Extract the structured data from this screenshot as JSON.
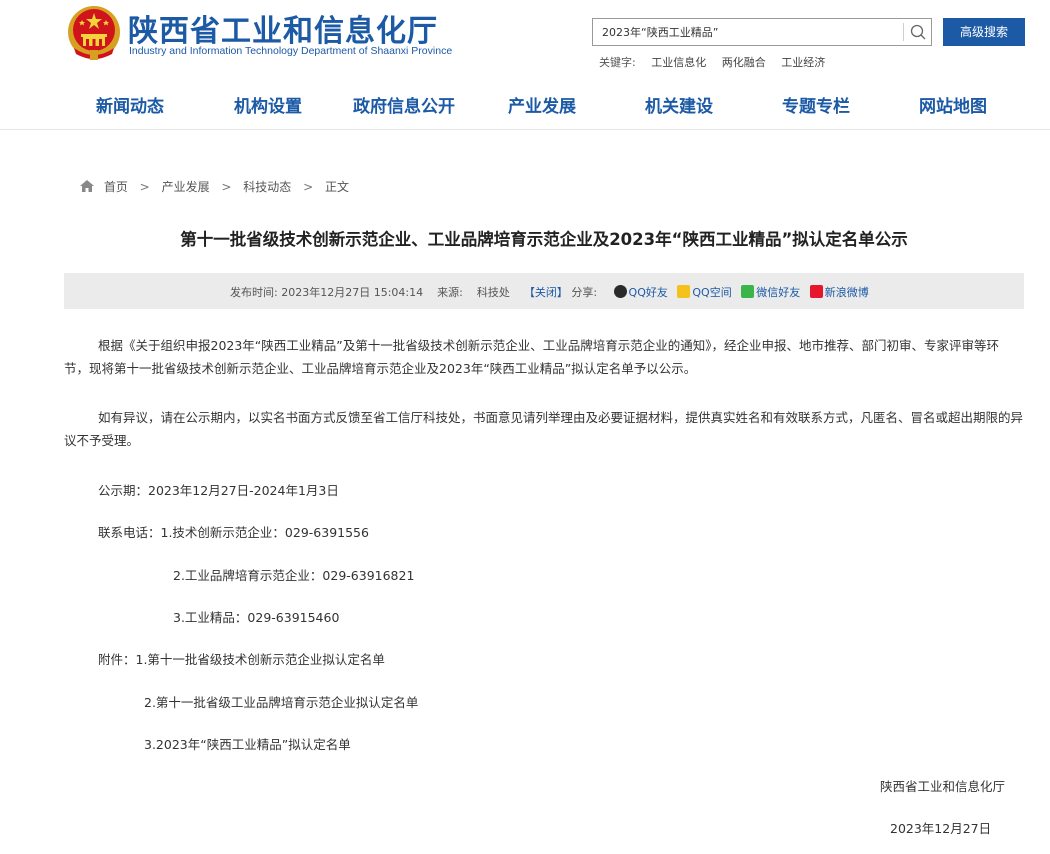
{
  "header": {
    "title": "陕西省工业和信息化厅",
    "subtitle": "Industry and Information Technology Department of Shaanxi Province"
  },
  "search": {
    "value": "2023年“陕西工业精品”",
    "advanced_label": "高级搜索"
  },
  "keywords": {
    "label": "关键字:",
    "items": [
      "工业信息化",
      "两化融合",
      "工业经济"
    ]
  },
  "nav": {
    "items": [
      "新闻动态",
      "机构设置",
      "政府信息公开",
      "产业发展",
      "机关建设",
      "专题专栏",
      "网站地图"
    ]
  },
  "breadcrumb": {
    "items": [
      "首页",
      "产业发展",
      "科技动态",
      "正文"
    ],
    "separator": ">"
  },
  "article": {
    "title": "第十一批省级技术创新示范企业、工业品牌培育示范企业及2023年“陕西工业精品”拟认定名单公示",
    "meta": {
      "time_label": "发布时间:",
      "time": "2023年12月27日 15:04:14",
      "source_label": "来源:",
      "source": "科技处",
      "close": "【关闭】",
      "share_label": "分享:",
      "shares": [
        "QQ好友",
        "QQ空间",
        "微信好友",
        "新浪微博"
      ]
    },
    "paragraphs": [
      "根据《关于组织申报2023年“陕西工业精品”及第十一批省级技术创新示范企业、工业品牌培育示范企业的通知》，经企业申报、地市推荐、部门初审、专家评审等环节，现将第十一批省级技术创新示范企业、工业品牌培育示范企业及2023年“陕西工业精品”拟认定名单予以公示。",
      "如有异议，请在公示期内，以实名书面方式反馈至省工信厅科技处，书面意见请列举理由及必要证据材料，提供真实姓名和有效联系方式，凡匿名、冒名或超出期限的异议不予受理。"
    ],
    "period": "公示期：2023年12月27日-2024年1月3日",
    "contacts": [
      "联系电话：1.技术创新示范企业：029-6391556",
      "2.工业品牌培育示范企业：029-63916821",
      "3.工业精品：029-63915460"
    ],
    "attachments": [
      "附件：1.第十一批省级技术创新示范企业拟认定名单",
      "2.第十一批省级工业品牌培育示范企业拟认定名单",
      "3.2023年“陕西工业精品”拟认定名单"
    ],
    "signature": "陕西省工业和信息化厅",
    "date": "2023年12月27日"
  },
  "colors": {
    "brand_blue": "#1c5aa6",
    "meta_bar": "#ebebeb"
  }
}
